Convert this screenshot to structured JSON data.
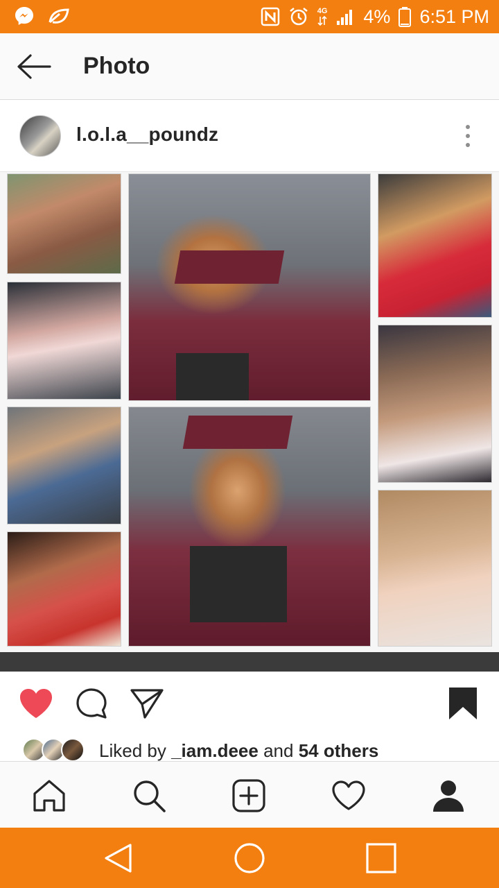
{
  "status_bar": {
    "left_icons": [
      "messenger-icon",
      "leaf-notification-icon"
    ],
    "right_icons": [
      "nfc-icon",
      "alarm-icon",
      "lte-4g-icon",
      "signal-icon",
      "battery-icon"
    ],
    "network_label": "4G",
    "battery": "4%",
    "time": "6:51 PM",
    "background": "#f37f10"
  },
  "app_bar": {
    "title": "Photo",
    "back_icon": "arrow-left-icon"
  },
  "post": {
    "username": "l.o.l.a__poundz",
    "more_icon": "more-vertical-icon",
    "photo_description_icon": "collage-photo"
  },
  "actions": {
    "liked": true,
    "like_color": "#ed4956",
    "like_icon": "heart-filled-icon",
    "comment_icon": "comment-icon",
    "share_icon": "share-icon",
    "save_icon": "bookmark-filled-icon"
  },
  "likes": {
    "prefix": "Liked by",
    "user": "_iam.deee",
    "joiner": "and",
    "others": "54 others"
  },
  "bottom_nav": {
    "items": [
      "home-icon",
      "search-icon",
      "add-post-icon",
      "activity-heart-icon",
      "profile-icon"
    ]
  },
  "system_nav": {
    "items": [
      "back-triangle-icon",
      "home-circle-icon",
      "recents-square-icon"
    ],
    "background": "#f37f10"
  }
}
